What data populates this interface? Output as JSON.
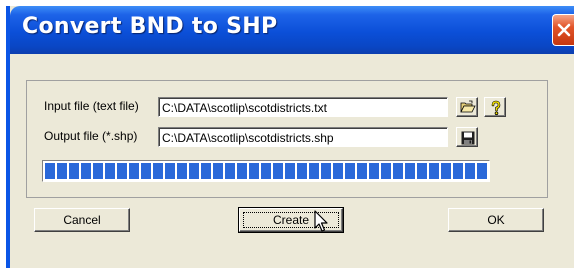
{
  "window": {
    "title": "Convert BND to SHP",
    "close_icon": "close-icon",
    "colors": {
      "titlebar": "#0a46c4",
      "body": "#ece9d8",
      "close": "#e2552a",
      "progress": "#2968d9"
    }
  },
  "input": {
    "label": "Input file (text file)",
    "value": "C:\\DATA\\scotlip\\scotdistricts.txt",
    "browse_icon": "open-folder-icon",
    "help_icon": "help-question-icon"
  },
  "output": {
    "label": "Output file (*.shp)",
    "value": "C:\\DATA\\scotlip\\scotdistricts.shp",
    "save_icon": "save-disk-icon"
  },
  "progress": {
    "fraction": 1.0
  },
  "buttons": {
    "cancel": "Cancel",
    "create": "Create",
    "ok": "OK"
  }
}
